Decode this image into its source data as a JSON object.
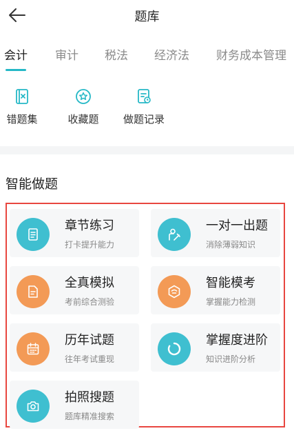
{
  "header": {
    "title": "题库",
    "back_icon": "arrow-left-icon"
  },
  "tabs": [
    {
      "label": "会计",
      "active": true
    },
    {
      "label": "审计",
      "active": false
    },
    {
      "label": "税法",
      "active": false
    },
    {
      "label": "经济法",
      "active": false
    },
    {
      "label": "财务成本管理",
      "active": false
    }
  ],
  "accent_color": "#25b8c6",
  "quick_actions": [
    {
      "label": "错题集",
      "icon": "wrong-book-icon"
    },
    {
      "label": "收藏题",
      "icon": "star-badge-icon"
    },
    {
      "label": "做题记录",
      "icon": "record-icon"
    }
  ],
  "section": {
    "title": "智能做题"
  },
  "highlight_color": "#e8463f",
  "cards": [
    {
      "title": "章节练习",
      "subtitle": "打卡提升能力",
      "color": "#3fbfd0",
      "icon": "document-icon"
    },
    {
      "title": "一对一出题",
      "subtitle": "消除薄弱知识",
      "color": "#3fbfd0",
      "icon": "person-pen-icon"
    },
    {
      "title": "全真模拟",
      "subtitle": "考前综合测验",
      "color": "#f39a56",
      "icon": "exam-paper-icon"
    },
    {
      "title": "智能模考",
      "subtitle": "掌握能力检测",
      "color": "#f39a56",
      "icon": "smart-hexagon-icon"
    },
    {
      "title": "历年试题",
      "subtitle": "往年考试重现",
      "color": "#f39a56",
      "icon": "calendar-icon"
    },
    {
      "title": "掌握度进阶",
      "subtitle": "知识进阶分析",
      "color": "#3fbfd0",
      "icon": "progress-ring-icon"
    },
    {
      "title": "拍照搜题",
      "subtitle": "题库精准搜索",
      "color": "#3fbfd0",
      "icon": "camera-icon"
    }
  ]
}
